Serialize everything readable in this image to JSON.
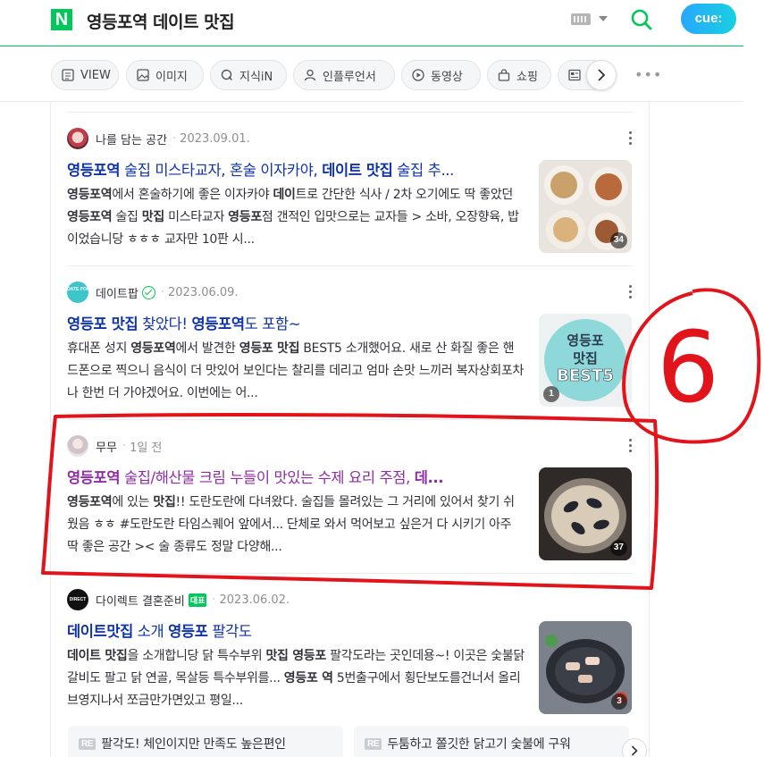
{
  "header": {
    "logo_text": "N",
    "query": "영등포역 데이트 맛집",
    "cue_label": "cue:",
    "accent_color": "#03c75a"
  },
  "tabs": [
    {
      "label": "VIEW",
      "icon": "document-icon"
    },
    {
      "label": "이미지",
      "icon": "image-icon"
    },
    {
      "label": "지식iN",
      "icon": "q-icon"
    },
    {
      "label": "인플루언서",
      "icon": "person-icon"
    },
    {
      "label": "동영상",
      "icon": "play-icon"
    },
    {
      "label": "쇼핑",
      "icon": "bag-icon"
    }
  ],
  "results": [
    {
      "author": "나를 담는 공간",
      "date": "2023.09.01.",
      "title_segments": [
        "영등포역",
        " 술집 미스타교자, 혼술 이자카야, ",
        "데이트 맛집",
        " 술집 추..."
      ],
      "desc_segments": [
        "영등포역",
        "에서 혼술하기에 좋은 이자카야 ",
        "데이",
        "트로 간단한 식사 / 2차 오기에도 딱 좋았던 ",
        "영등포역",
        " 술집 ",
        "맛집",
        " 미스타교자 ",
        "영등포",
        "점 갠적인 입맛으로는 교자들 > 소바, 오장향육, 밥 이었습니당 ㅎㅎㅎ 교자만 10판 시..."
      ],
      "thumb_count": "34"
    },
    {
      "author": "데이트팝",
      "avatar_text": "DATE POP",
      "date": "2023.06.09.",
      "title_segments": [
        "영등포 맛집",
        " 찾았다! ",
        "영등포역",
        "도 포함~"
      ],
      "desc_segments": [
        "휴대폰 성지 ",
        "영등포역",
        "에서 발견한 ",
        "영등포 맛집",
        " BEST5 소개했어요. 새로 산 화질 좋은 핸드폰으로 찍으니 음식이 더 맛있어 보인다는 찰리를 데리고 엄마 손맛 느끼러 복자상회포차나 한번 더 가야겠어요. 이번에는 어..."
      ],
      "thumb_lines": [
        "영등포",
        "맛집",
        "BEST5"
      ],
      "thumb_count": "1"
    },
    {
      "author": "무무",
      "date": "1일 전",
      "title_segments": [
        "영등포역",
        " 술집/해산물 크림 누들이 맛있는 수제 요리 주점, ",
        "데..."
      ],
      "desc_segments": [
        "영등포역",
        "에 있는 ",
        "맛집",
        "!! 도란도란에 다녀왔다. 술집들 몰려있는 그 거리에 있어서 찾기 쉬웠음 ㅎㅎ #도란도란 타임스퀘어 앞에서... 단체로 와서 먹어보고 싶은거 다 시키기 아주 딱 좋은 공간 >< 술 종류도 정말 다양해..."
      ],
      "thumb_count": "37"
    },
    {
      "author": "다이렉트 결혼준비",
      "avatar_text": "DIRECT",
      "rep_badge": "대표",
      "date": "2023.06.02.",
      "title_segments": [
        "데이트맛집",
        " 소개 ",
        "영등포",
        " 팔각도"
      ],
      "desc_segments": [
        "데이트 맛집",
        "을 소개합니당 닭 특수부위 ",
        "맛집 영등포",
        " 팔각도라는 곳인데용~! 이곳은 숯불닭갈비도 팔고 닭 연골, 목살등 특수부위를... ",
        "영등포 역",
        " 5번출구에서 횡단보도를건너서 올리브영지나서 쪼금만가면있고 평일..."
      ],
      "thumb_count": "3"
    }
  ],
  "related": [
    {
      "badge": "RE",
      "text": "팔각도! 체인이지만 만족도 높은편인"
    },
    {
      "badge": "RE",
      "text": "두툼하고 쫄깃한 닭고기 숯불에 구워"
    }
  ],
  "annotation": {
    "label": "6",
    "color": "#e1141b"
  }
}
